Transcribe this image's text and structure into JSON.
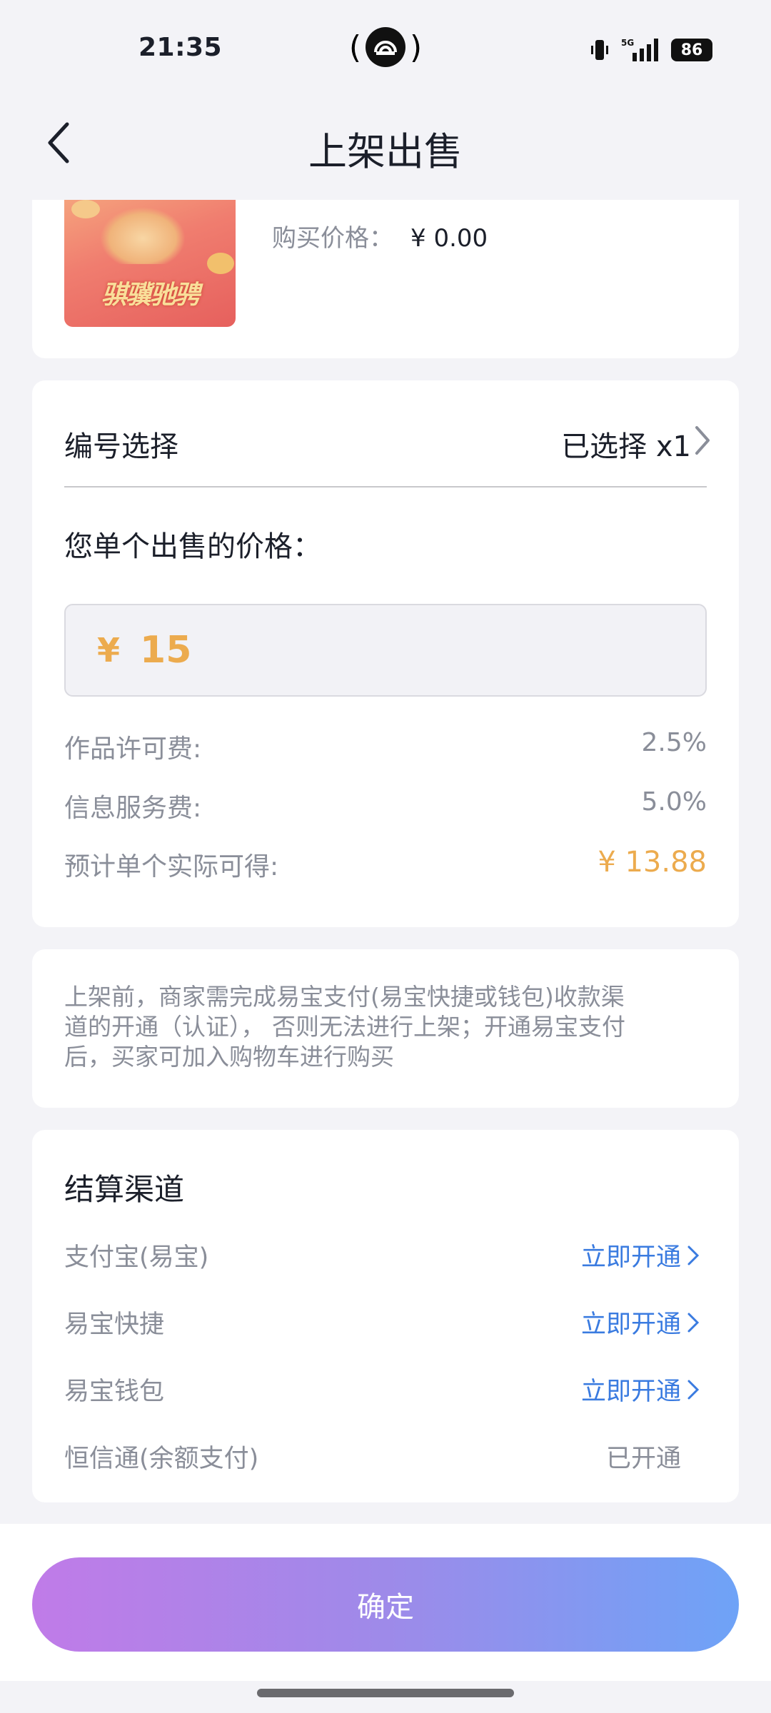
{
  "status": {
    "time": "21:35",
    "network": "5G",
    "battery": "86"
  },
  "header": {
    "title": "上架出售",
    "back_icon": "chevron-left-icon"
  },
  "product": {
    "thumb_text": "骐骥驰骋",
    "buy_price_label": "购买价格：",
    "buy_price_value": "¥ 0.00"
  },
  "sell": {
    "number_select_label": "编号选择",
    "number_select_value": "已选择 x1",
    "price_label": "您单个出售的价格：",
    "price_currency": "¥",
    "price_value": "15",
    "fees": [
      {
        "label": "作品许可费:",
        "value": "2.5%"
      },
      {
        "label": "信息服务费:",
        "value": "5.0%"
      },
      {
        "label": "预计单个实际可得:",
        "value": "¥ 13.88"
      }
    ]
  },
  "notice": {
    "line1": "上架前，商家需完成易宝支付(易宝快捷或钱包)收款渠",
    "line2": "道的开通（认证）， 否则无法进行上架；开通易宝支付",
    "line3": "后，买家可加入购物车进行购买"
  },
  "channels": {
    "title": "结算渠道",
    "items": [
      {
        "label": "支付宝(易宝)",
        "action": "立即开通"
      },
      {
        "label": "易宝快捷",
        "action": "立即开通"
      },
      {
        "label": "易宝钱包",
        "action": "立即开通"
      },
      {
        "label": "恒信通(余额支付)",
        "status": "已开通"
      }
    ]
  },
  "footer": {
    "confirm_label": "确定"
  },
  "colors": {
    "accent_orange": "#ecab4e",
    "link_blue": "#3a7be0",
    "button_gradient_start": "#c07be8",
    "button_gradient_end": "#6ea3f7"
  }
}
